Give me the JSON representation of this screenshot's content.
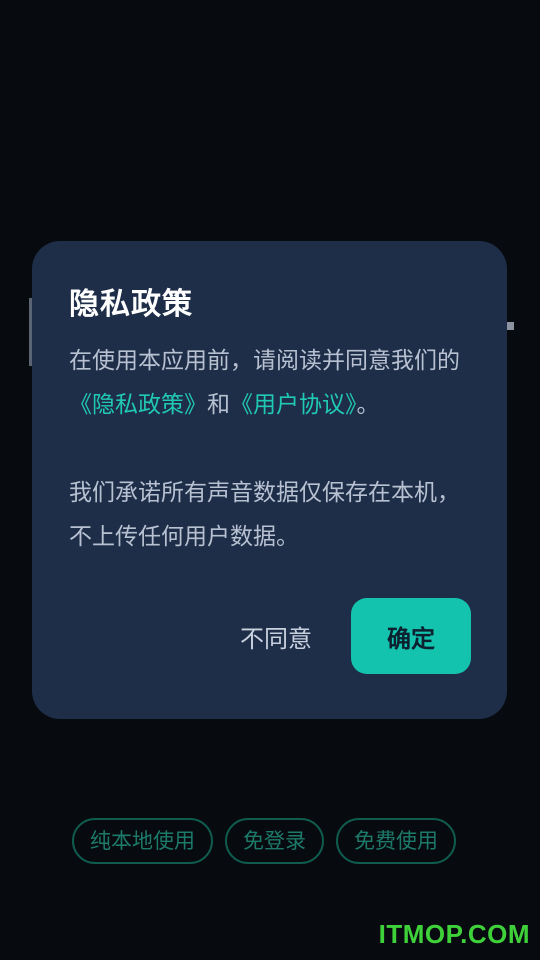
{
  "dialog": {
    "title": "隐私政策",
    "body_line1_prefix": "在使用本应用前，请阅读并同意我们的",
    "privacy_link": "《隐私政策》",
    "conjunction": "和",
    "agreement_link": "《用户协议》",
    "body_line1_suffix": "。",
    "body_paragraph2": "我们承诺所有声音数据仅保存在本机，不上传任何用户数据。",
    "disagree_label": "不同意",
    "confirm_label": "确定"
  },
  "tags": [
    "纯本地使用",
    "免登录",
    "免费使用"
  ],
  "watermark": "ITMOP.COM",
  "colors": {
    "background": "#070a0f",
    "dialog": "#1f2e48",
    "accent": "#13c3ae",
    "link": "#20c9b3",
    "watermark": "#3fd13a"
  }
}
